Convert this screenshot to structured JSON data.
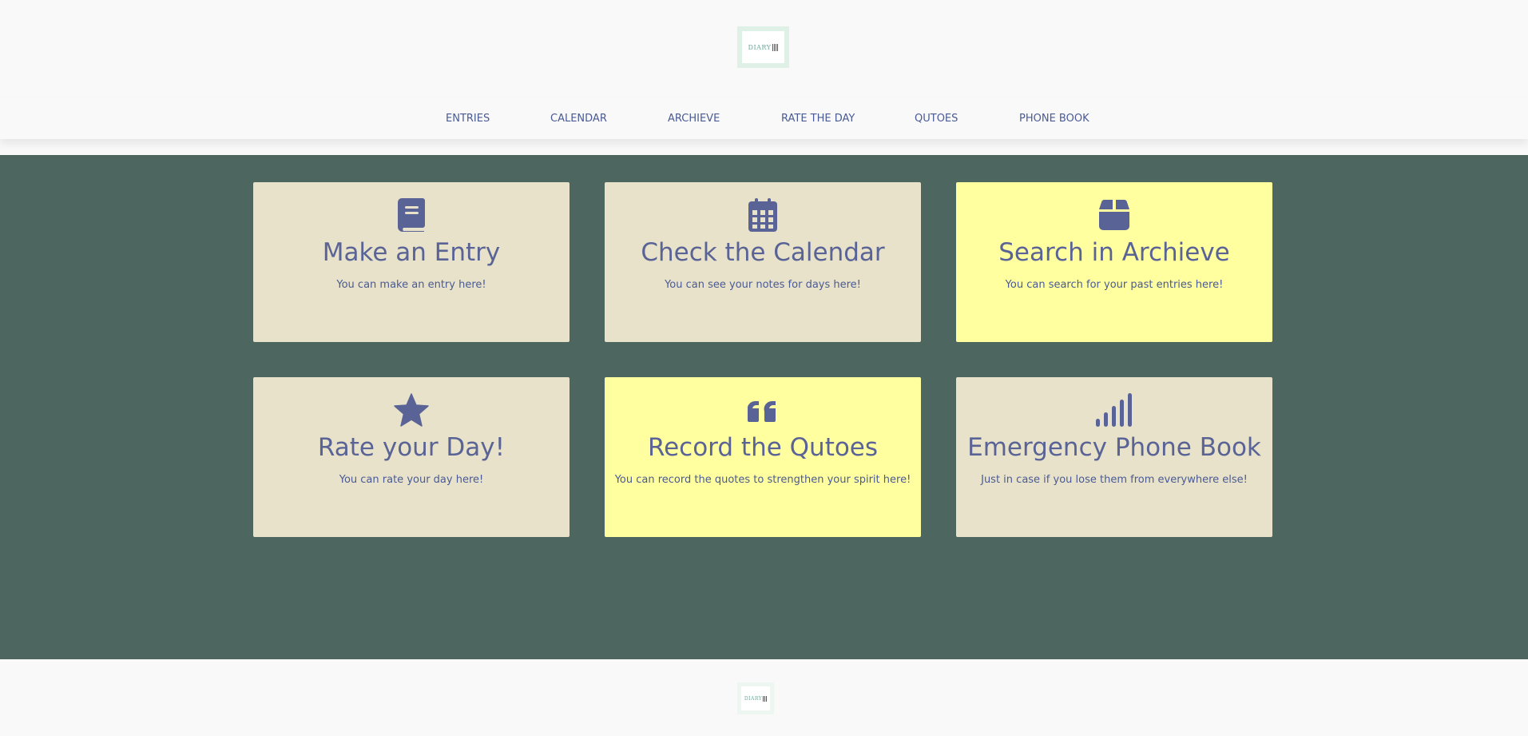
{
  "logo": {
    "text": "DIARY"
  },
  "nav": {
    "items": [
      {
        "label": "ENTRIES"
      },
      {
        "label": "CALENDAR"
      },
      {
        "label": "ARCHIEVE"
      },
      {
        "label": "RATE THE DAY"
      },
      {
        "label": "QUTOES"
      },
      {
        "label": "PHONE BOOK"
      }
    ]
  },
  "cards": [
    {
      "icon": "book-icon",
      "title": "Make an Entry",
      "description": "You can make an entry here!",
      "color": "#e7e2c9"
    },
    {
      "icon": "calendar-icon",
      "title": "Check the Calendar",
      "description": "You can see your notes for days here!",
      "color": "#e7e2c9"
    },
    {
      "icon": "archive-box-icon",
      "title": "Search in Archieve",
      "description": "You can search for your past entries here!",
      "color": "#ffff9f"
    },
    {
      "icon": "star-icon",
      "title": "Rate your Day!",
      "description": "You can rate your day here!",
      "color": "#e7e2c9"
    },
    {
      "icon": "quote-icon",
      "title": "Record the Qutoes",
      "description": "You can record the quotes to strengthen your spirit here!",
      "color": "#ffff9f"
    },
    {
      "icon": "signal-icon",
      "title": "Emergency Phone Book",
      "description": "Just in case if you lose them from everywhere else!",
      "color": "#e7e2c9"
    }
  ],
  "footer": {
    "logo_text": "DIARY"
  },
  "colors": {
    "main_background": "#4d665f",
    "card_beige": "#e7e2c9",
    "card_yellow": "#ffff9f",
    "accent_text": "#5a6396",
    "page_background": "#f9f9f9"
  }
}
